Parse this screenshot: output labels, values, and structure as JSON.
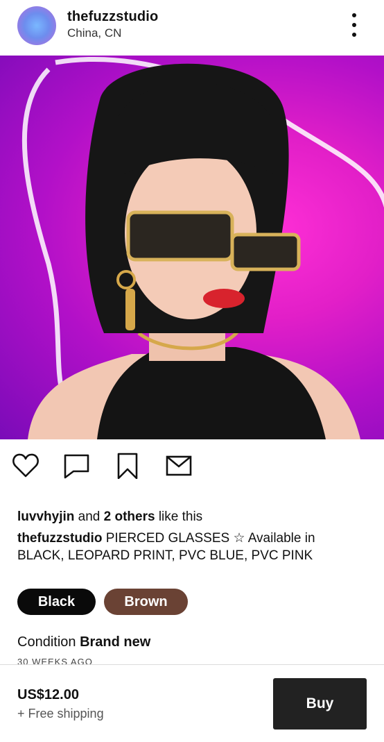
{
  "header": {
    "username": "thefuzzstudio",
    "location": "China, CN",
    "more_icon": "more-vertical-icon"
  },
  "carousel": {
    "image_description_icon": "product-photo",
    "active_dot_color": "#e8251f",
    "inactive_dot_color": "#e6e6e6",
    "slide_count": 2,
    "active_index": 1
  },
  "actions": {
    "like_icon": "heart-icon",
    "comment_icon": "comment-icon",
    "save_icon": "bookmark-icon",
    "share_icon": "mail-icon"
  },
  "likes": {
    "user": "luvvhyjin",
    "and_text": " and ",
    "others": "2 others",
    "suffix": " like this"
  },
  "caption": {
    "author": "thefuzzstudio",
    "text": " PIERCED GLASSES ☆ Available in BLACK, LEOPARD PRINT, PVC BLUE, PVC PINK"
  },
  "variants": [
    {
      "label": "Black",
      "color": "#0a0a0a"
    },
    {
      "label": "Brown",
      "color": "#6a4234"
    }
  ],
  "condition": {
    "label": "Condition ",
    "value": "Brand new"
  },
  "posted": "30 WEEKS AGO",
  "footer": {
    "price": "US$12.00",
    "shipping": "+ Free shipping",
    "buy_label": "Buy"
  }
}
